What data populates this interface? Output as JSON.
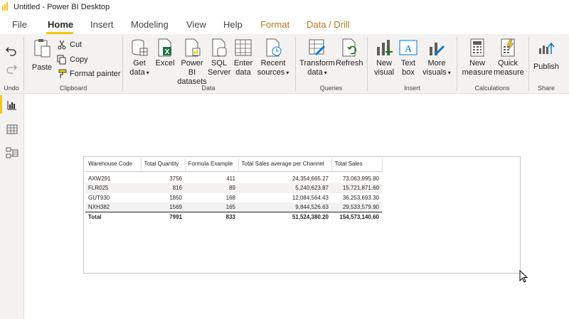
{
  "titlebar": {
    "title": "Untitled - Power BI Desktop"
  },
  "tabs": [
    {
      "label": "File"
    },
    {
      "label": "Home"
    },
    {
      "label": "Insert"
    },
    {
      "label": "Modeling"
    },
    {
      "label": "View"
    },
    {
      "label": "Help"
    },
    {
      "label": "Format"
    },
    {
      "label": "Data / Drill"
    }
  ],
  "ribbon": {
    "undo": {
      "group": "Undo"
    },
    "clipboard": {
      "paste": "Paste",
      "cut": "Cut",
      "copy": "Copy",
      "format_painter": "Format painter",
      "group": "Clipboard"
    },
    "data": {
      "get_data": [
        "Get",
        "data"
      ],
      "excel": "Excel",
      "pbi_datasets": [
        "Power BI",
        "datasets"
      ],
      "sql_server": [
        "SQL",
        "Server"
      ],
      "enter_data": [
        "Enter",
        "data"
      ],
      "recent_sources": [
        "Recent",
        "sources"
      ],
      "group": "Data"
    },
    "queries": {
      "transform": [
        "Transform",
        "data"
      ],
      "refresh": "Refresh",
      "group": "Queries"
    },
    "insert": {
      "new_visual": [
        "New",
        "visual"
      ],
      "text_box": [
        "Text",
        "box"
      ],
      "more_visuals": [
        "More",
        "visuals"
      ],
      "group": "Insert"
    },
    "calculations": {
      "new_measure": [
        "New",
        "measure"
      ],
      "quick_measure": [
        "Quick",
        "measure"
      ],
      "group": "Calculations"
    },
    "share": {
      "publish": "Publish",
      "group": "Share"
    }
  },
  "colors": {
    "accent": "#f2c811",
    "excel_green": "#217346",
    "context_tab": "#b7791f"
  },
  "table": {
    "columns": [
      "Warehouse Code",
      "Total Quantity",
      "Formula Example",
      "Total Sales average per Channel",
      "Total Sales"
    ],
    "rows": [
      [
        "AXW291",
        "3756",
        "411",
        "24,354,665.27",
        "73,063,995.80"
      ],
      [
        "FLR025",
        "816",
        "89",
        "5,240,623.87",
        "15,721,871.60"
      ],
      [
        "GUT930",
        "1850",
        "168",
        "12,084,564.43",
        "36,253,693.30"
      ],
      [
        "NXH382",
        "1569",
        "165",
        "9,844,526.63",
        "29,533,579.90"
      ]
    ],
    "total": [
      "Total",
      "7991",
      "833",
      "51,524,380.20",
      "154,573,140.60"
    ]
  }
}
